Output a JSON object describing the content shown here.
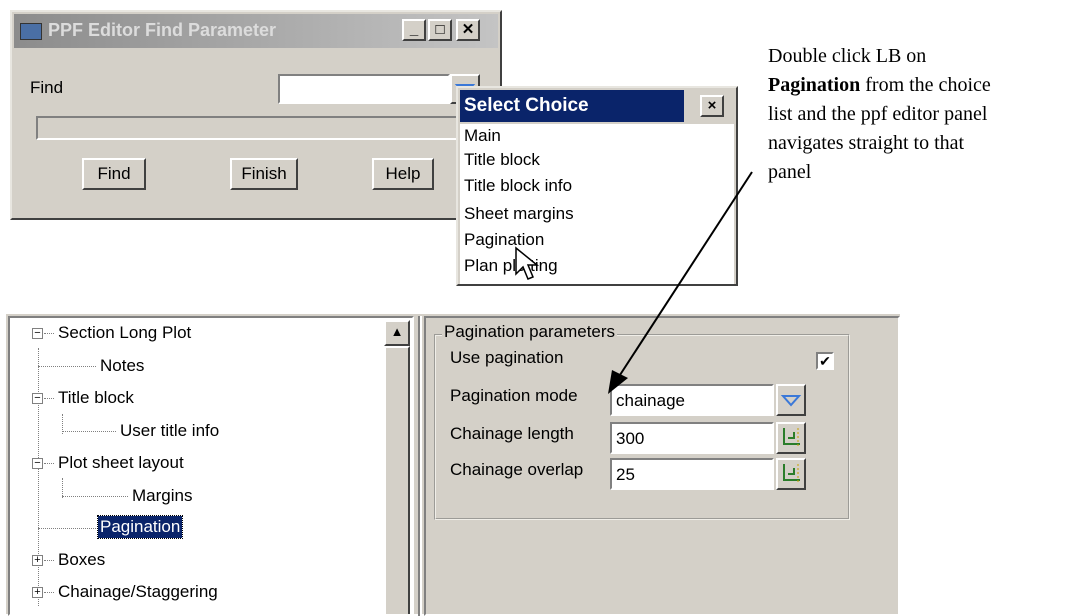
{
  "find_dialog": {
    "title": "PPF Editor Find Parameter",
    "find_label": "Find",
    "find_value": "",
    "buttons": {
      "find": "Find",
      "finish": "Finish",
      "help": "Help"
    }
  },
  "choice_popup": {
    "title": "Select Choice",
    "close": "×",
    "items": [
      "Main",
      "Title block",
      "Title block info",
      "Sheet margins",
      "Pagination",
      "Plan plotting"
    ]
  },
  "annotation": {
    "line1": "Double click LB on",
    "bold": "Pagination",
    "line2_rest": " from the choice",
    "line3": "list and the ppf editor panel",
    "line4": "navigates straight to that",
    "line5": "panel"
  },
  "tree": {
    "items": [
      "Section Long Plot",
      "Notes",
      "Title block",
      "User title info",
      "Plot sheet layout",
      "Margins",
      "Pagination",
      "Boxes",
      "Chainage/Staggering"
    ],
    "selected_index": 6,
    "scroll_up": "▲"
  },
  "pagination_panel": {
    "group_title": "Pagination parameters",
    "use_pagination_label": "Use pagination",
    "use_pagination_checked": "✔",
    "mode_label": "Pagination mode",
    "mode_value": "chainage",
    "length_label": "Chainage length",
    "length_value": "300",
    "overlap_label": "Chainage overlap",
    "overlap_value": "25"
  },
  "colors": {
    "window_bg": "#d4d0c8",
    "popup_title": "#0a246a",
    "selection": "#0a246a",
    "drop_arrow": "#3a78d8"
  }
}
